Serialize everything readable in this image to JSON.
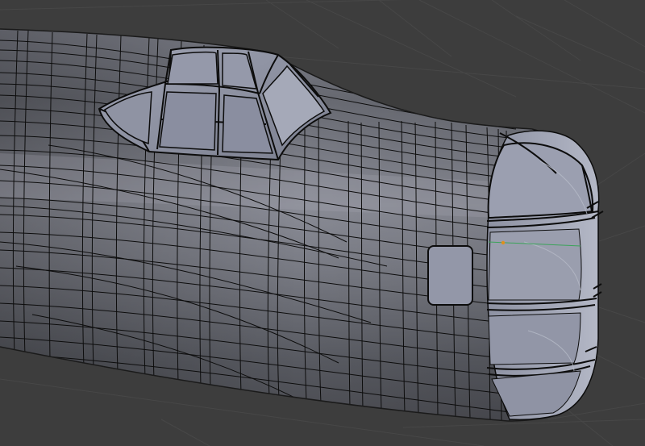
{
  "viewport": {
    "background_color": "#3d3d3d",
    "grid_color": "#474747",
    "mesh_color": "#666870",
    "mesh_highlight_color": "#9a9aa6",
    "glass_color": "#8f93a3",
    "nose_glass_color": "#9599aa",
    "wire_color": "#0c0c0c",
    "selected_vertex_color": "#e0901c",
    "selected_edge_color": "#3ca35a"
  }
}
